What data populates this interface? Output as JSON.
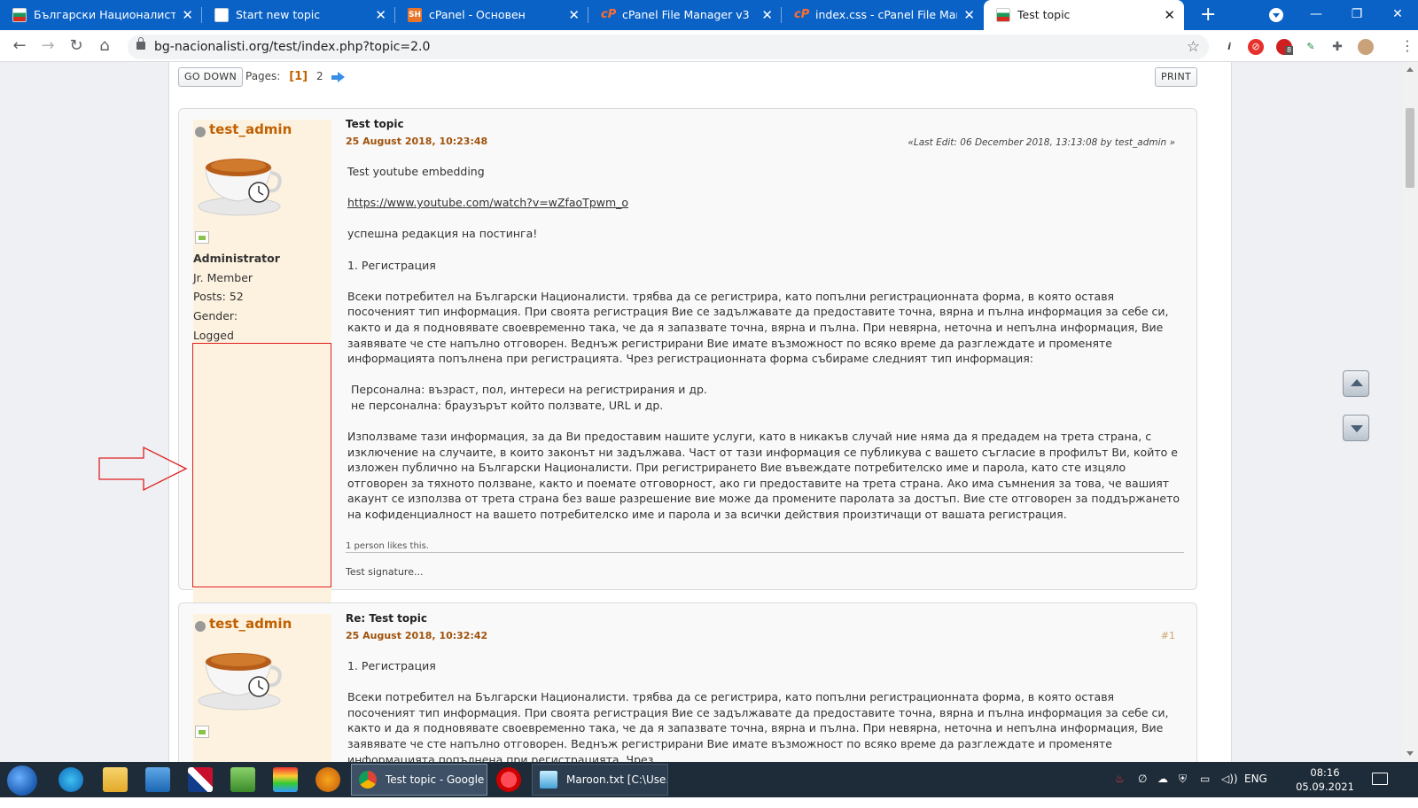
{
  "browser": {
    "tabs": [
      {
        "title": "Български Националистическ",
        "favicon": "bulgarian-flag-icon"
      },
      {
        "title": "Start new topic",
        "favicon": "magnifier-page-icon"
      },
      {
        "title": "cPanel - Основен",
        "favicon": "sh-logo-icon"
      },
      {
        "title": "cPanel File Manager v3",
        "favicon": "cpanel-icon"
      },
      {
        "title": "index.css - cPanel File Manage",
        "favicon": "cpanel-icon"
      },
      {
        "title": "Test topic",
        "favicon": "bulgarian-flag-icon",
        "active": true
      }
    ],
    "url": "bg-nacionalisti.org/test/index.php?topic=2.0",
    "extension_badge": "8"
  },
  "page": {
    "go_down_label": "GO DOWN",
    "pages_label": "Pages:",
    "current_page": "[1]",
    "next_page": "2",
    "print_label": "PRINT"
  },
  "posts": [
    {
      "author": "test_admin",
      "role": "Administrator",
      "rank": "Jr. Member",
      "posts": "Posts: 52",
      "gender": "Gender:",
      "status": "Logged",
      "subject": "Test topic",
      "date": "25 August 2018, 10:23:48",
      "last_edit": "«Last Edit: 06 December 2018, 13:13:08 by test_admin »",
      "body": {
        "intro": "Test youtube embedding",
        "link": "https://www.youtube.com/watch?v=wZfaoTpwm_o",
        "edited": "успешна редакция на постинга!",
        "heading": "1. Регистрация",
        "para1": "Всеки потребител на Български Националисти. трябва да се регистрира, като попълни регистрационната форма, в която оставя посоченият тип информация. При своята регистрация Вие се задължавате да предоставите точна, вярна и пълна информация за себе си, както и да я подновявате своевременно така, че да я запазвате точна, вярна и пълна. При невярна, неточна и непълна информация, Вие заявявате че сте напълно отговорен. Веднъж регистрирани Вие имате възможност по всяко време да разглеждате и променяте информацията попълнена при регистрацията. Чрез регистрационната форма събираме следният тип информация:",
        "item1": " Персонална: възраст, пол, интереси на регистрирания и др.",
        "item2": "не персонална: браузърът който ползвате, URL и др.",
        "para2": "Използваме тази информация, за да Ви предоставим нашите услуги, като в никакъв случай ние няма да я предадем на трета страна, с изключение на случаите, в които законът ни задължава. Част от тази информация се публикува с вашето съгласие в профилът Ви, който е изложен публично на Български Националисти. При регистрирането Вие въвеждате потребителско име и парола, като сте изцяло отговорен за тяхното ползване, както и поемате отговорност, ако ги предоставите на трета страна. Ако има съмнения за това, че вашият акаунт се използва от трета страна без ваше разрешение вие може да промените паролата за достъп. Вие сте отговорен за поддържането на кофиденциалност на вашето потребителско име и парола и за всички действия произтичащи от вашата регистрация."
      },
      "likes": "1 person likes this.",
      "signature": "Test signature..."
    },
    {
      "author": "test_admin",
      "subject": "Re: Test topic",
      "date": "25 August 2018, 10:32:42",
      "number": "#1",
      "body": {
        "heading": "1. Регистрация",
        "para1": "Всеки потребител на Български Националисти. трябва да се регистрира, като попълни регистрационната форма, в която оставя посоченият тип информация. При своята регистрация Вие се задължавате да предоставите точна, вярна и пълна информация за себе си, както и да я подновявате своевременно така, че да я запазвате точна, вярна и пълна. При невярна, неточна и непълна информация, Вие заявявате че сте напълно отговорен. Веднъж регистрирани Вие имате възможност по всяко време да разглеждате и променяте информацията попълнена при регистрацията. Чрез"
      }
    }
  ],
  "taskbar": {
    "tasks": [
      {
        "label": "Test topic - Google ...",
        "icon": "chrome-icon"
      },
      {
        "label": "Maroon.txt [C:\\Use...",
        "icon": "notepad-icon"
      }
    ],
    "lang": "ENG",
    "time": "08:16",
    "date": "05.09.2021 г."
  },
  "colors": {
    "tabbar": "#0a62c6",
    "username": "#c06000",
    "poster_bg": "#fdf2e0",
    "annotation": "#e02020"
  }
}
